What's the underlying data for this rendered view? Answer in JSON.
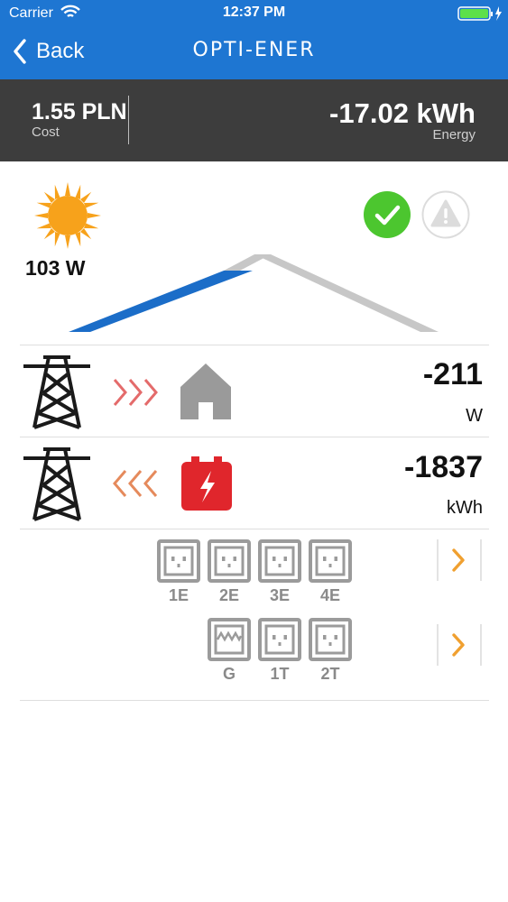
{
  "status_bar": {
    "carrier": "Carrier",
    "time": "12:37 PM"
  },
  "nav": {
    "back_label": "Back",
    "brand": "OPTI-ENER"
  },
  "summary": {
    "cost_value": "1.55 PLN",
    "cost_label": "Cost",
    "energy_value": "-17.02 kWh",
    "energy_label": "Energy"
  },
  "solar": {
    "power": "103 W",
    "status": "ok"
  },
  "colors": {
    "nav_blue": "#1e76d2",
    "summary_bg": "#3d3d3d",
    "ok_green": "#4cc62f",
    "battery_red": "#e0262c",
    "chevron_orange": "#f0a030",
    "arrow_pink": "#e46b6b",
    "arrow_orange": "#e58a5c"
  },
  "rows": [
    {
      "value": "-211",
      "unit": "W",
      "target": "house-icon",
      "direction": "grid-to-house"
    },
    {
      "value": "-1837",
      "unit": "kWh",
      "target": "battery-icon",
      "direction": "battery-to-grid"
    }
  ],
  "socket_groups": [
    {
      "labels": [
        "1E",
        "2E",
        "3E",
        "4E"
      ]
    },
    {
      "labels": [
        "G",
        "1T",
        "2T"
      ]
    }
  ]
}
